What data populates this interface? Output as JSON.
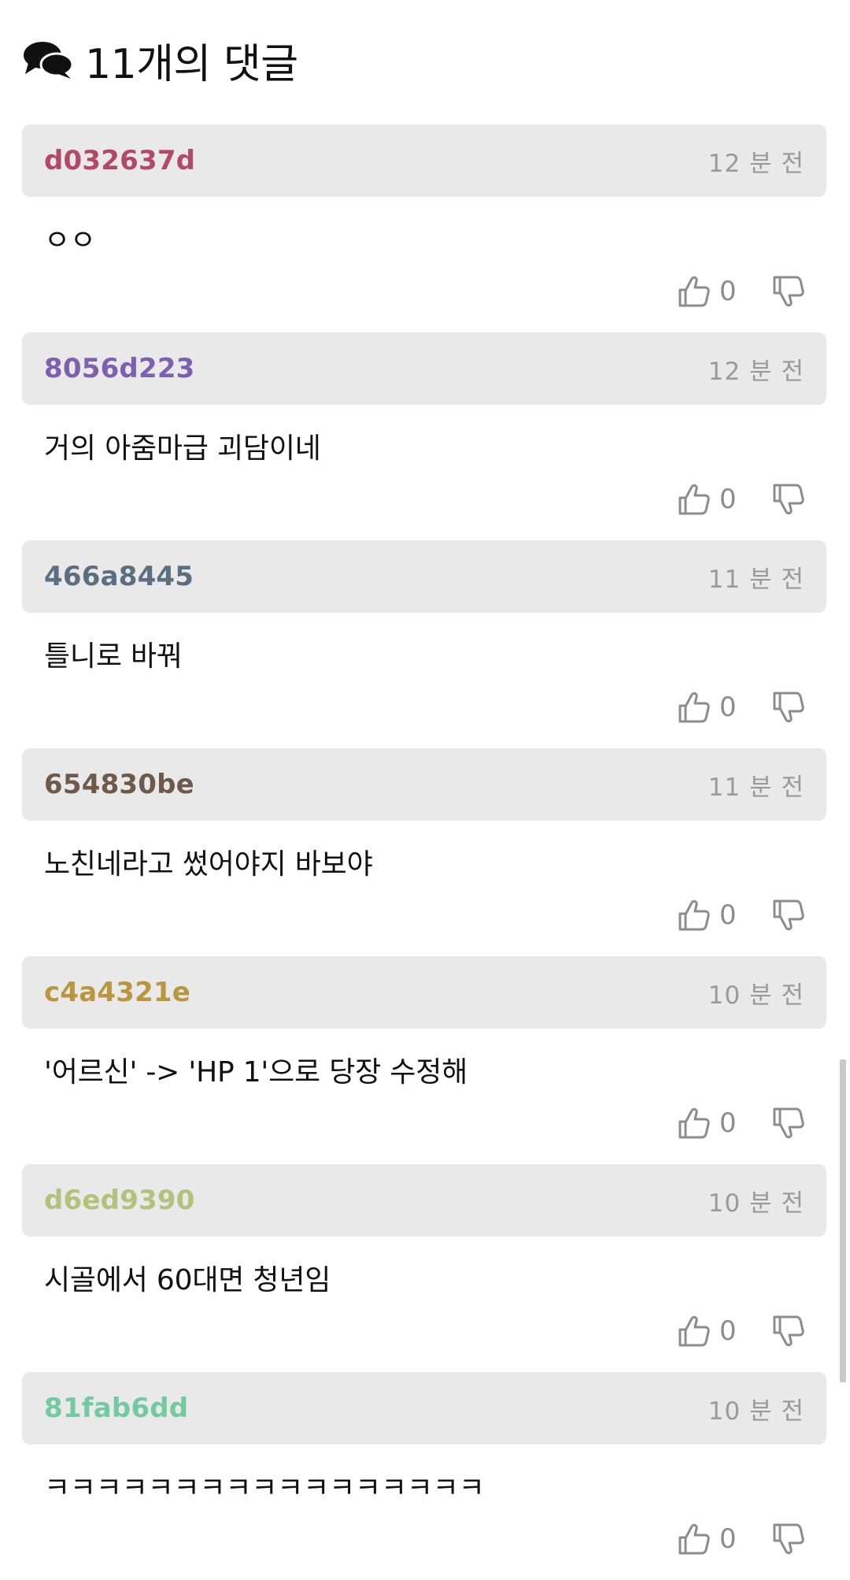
{
  "header": {
    "title": "11개의 댓글",
    "icon": "chat-bubbles-icon"
  },
  "comments": [
    {
      "author": "d032637d",
      "author_color": "#b24a67",
      "time": "12 분 전",
      "text": "ㅇㅇ",
      "likes": "0"
    },
    {
      "author": "8056d223",
      "author_color": "#7d60ae",
      "time": "12 분 전",
      "text": "거의 아줌마급 괴담이네",
      "likes": "0"
    },
    {
      "author": "466a8445",
      "author_color": "#5b6f80",
      "time": "11 분 전",
      "text": "틀니로 바꿔",
      "likes": "0"
    },
    {
      "author": "654830be",
      "author_color": "#6d5a4b",
      "time": "11 분 전",
      "text": "노친네라고 썼어야지 바보야",
      "likes": "0"
    },
    {
      "author": "c4a4321e",
      "author_color": "#b8973e",
      "time": "10 분 전",
      "text": "'어르신' -> 'HP 1'으로 당장 수정해",
      "likes": "0"
    },
    {
      "author": "d6ed9390",
      "author_color": "#b3c17a",
      "time": "10 분 전",
      "text": "시골에서 60대면 청년임",
      "likes": "0"
    },
    {
      "author": "81fab6dd",
      "author_color": "#73c9a0",
      "time": "10 분 전",
      "text": "ㅋㅋㅋㅋㅋㅋㅋㅋㅋㅋㅋㅋㅋㅋㅋㅋㅋ",
      "likes": "0"
    }
  ],
  "icons": {
    "like": "thumbs-up-icon",
    "dislike": "thumbs-down-icon"
  }
}
